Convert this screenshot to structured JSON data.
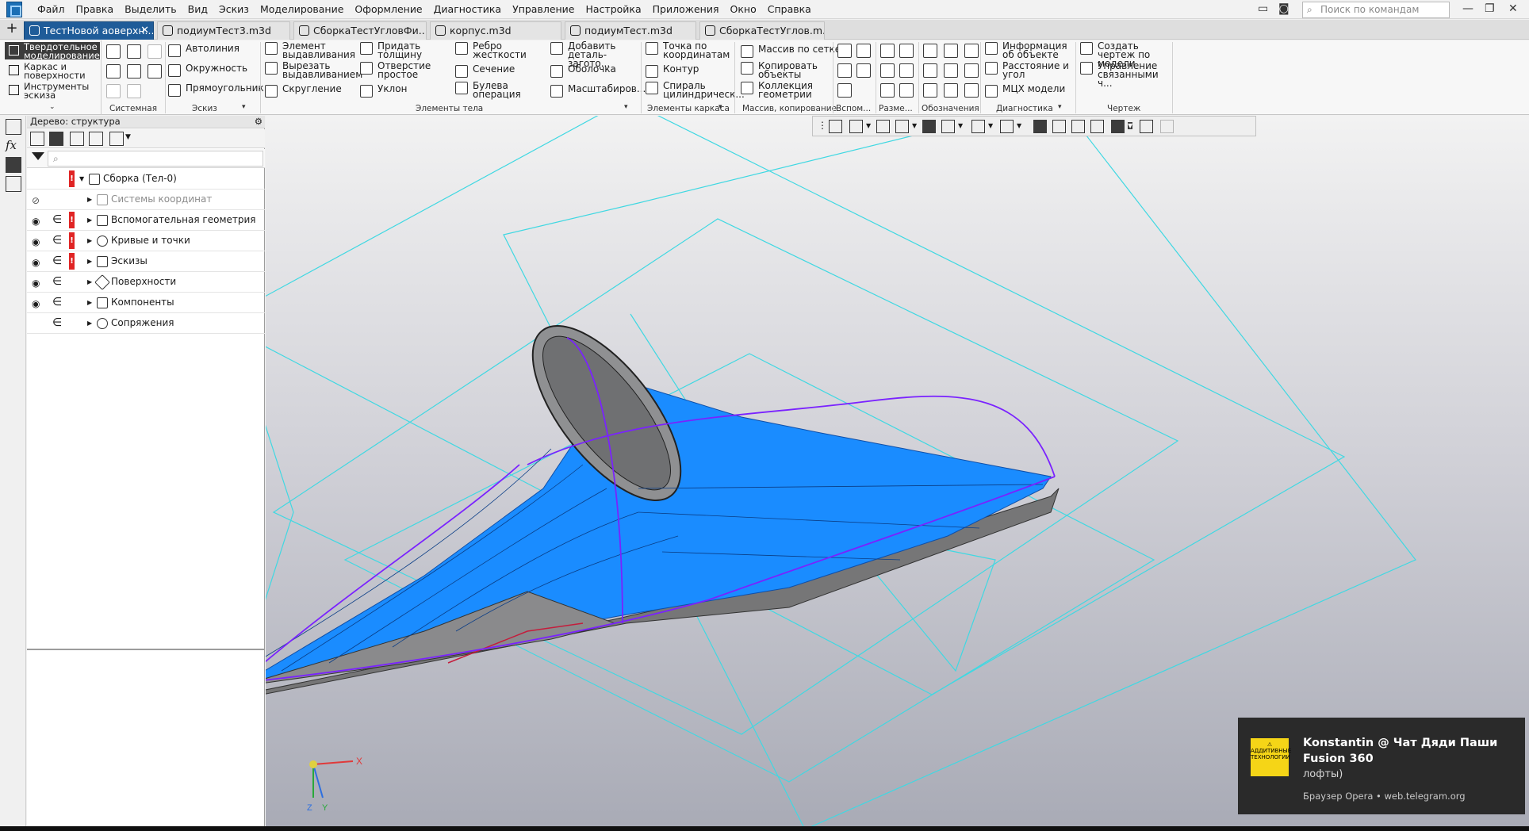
{
  "menubar": {
    "items": [
      "Файл",
      "Правка",
      "Выделить",
      "Вид",
      "Эскиз",
      "Моделирование",
      "Оформление",
      "Диагностика",
      "Управление",
      "Настройка",
      "Приложения",
      "Окно",
      "Справка"
    ],
    "search_placeholder": "Поиск по командам (Alt+/)"
  },
  "tabs": [
    {
      "label": "ТестНовой аоверхн...",
      "active": true
    },
    {
      "label": "подиумТест3.m3d",
      "active": false
    },
    {
      "label": "СборкаТестУгловФи...",
      "active": false
    },
    {
      "label": "корпус.m3d",
      "active": false
    },
    {
      "label": "подиумТест.m3d",
      "active": false
    },
    {
      "label": "СборкаТестУглов.m...",
      "active": false
    }
  ],
  "ribbon": {
    "modes": [
      "Твердотельное моделирование",
      "Каркас и поверхности",
      "Инструменты эскиза"
    ],
    "sketch": [
      "Автолиния",
      "Окружность",
      "Прямоугольник"
    ],
    "body_col1": [
      "Элемент выдавливания",
      "Вырезать выдавливанием",
      "Скругление"
    ],
    "body_col2": [
      "Придать толщину",
      "Отверстие простое",
      "Уклон"
    ],
    "body_col3": [
      "Ребро жесткости",
      "Сечение",
      "Булева операция"
    ],
    "body_col4": [
      "Добавить деталь-загото...",
      "Оболочка",
      "Масштабиров..."
    ],
    "frame": [
      "Точка по координатам",
      "Контур",
      "Спираль цилиндрическ..."
    ],
    "copy": [
      "Массив по сетке",
      "Копировать объекты",
      "Коллекция геометрии"
    ],
    "diag": [
      "Информация об объекте",
      "Расстояние и угол",
      "МЦХ модели"
    ],
    "drawing": [
      "Создать чертеж по модели",
      "Управление связанными ч..."
    ],
    "groups": [
      "Системная",
      "Эскиз",
      "Элементы тела",
      "Элементы каркаса",
      "Массив, копирование",
      "Вспом...",
      "Разме...",
      "Обозначения",
      "Диагностика",
      "Чертеж"
    ]
  },
  "tree": {
    "header": "Дерево: структура",
    "root": "Сборка (Тел-0)",
    "items": [
      {
        "label": "Системы координат",
        "dim": true,
        "eye": "hidden",
        "include": false,
        "warn": false
      },
      {
        "label": "Вспомогательная геометрия",
        "dim": false,
        "eye": "visible",
        "include": true,
        "warn": true
      },
      {
        "label": "Кривые и точки",
        "dim": false,
        "eye": "visible",
        "include": true,
        "warn": true
      },
      {
        "label": "Эскизы",
        "dim": false,
        "eye": "visible",
        "include": true,
        "warn": true
      },
      {
        "label": "Поверхности",
        "dim": false,
        "eye": "visible",
        "include": true,
        "warn": false
      },
      {
        "label": "Компоненты",
        "dim": false,
        "eye": "visible",
        "include": true,
        "warn": false
      },
      {
        "label": "Сопряжения",
        "dim": false,
        "eye": "none",
        "include": true,
        "warn": false
      }
    ]
  },
  "viewport": {
    "axes": {
      "x": "X",
      "y": "Y",
      "z": "Z"
    }
  },
  "notification": {
    "title": "Konstantin @ Чат Дяди Паши Fusion 360",
    "text": "лофты)",
    "source": "Браузер Opera • web.telegram.org",
    "logo_text": "АДДИТИВНЫЕ ТЕХНОЛОГИИ"
  },
  "colors": {
    "accent": "#1f5c99",
    "model_blue": "#1a8cff",
    "plane_cyan": "#3fd6e0",
    "curve_purple": "#7a22ff",
    "warn": "#e02424"
  }
}
